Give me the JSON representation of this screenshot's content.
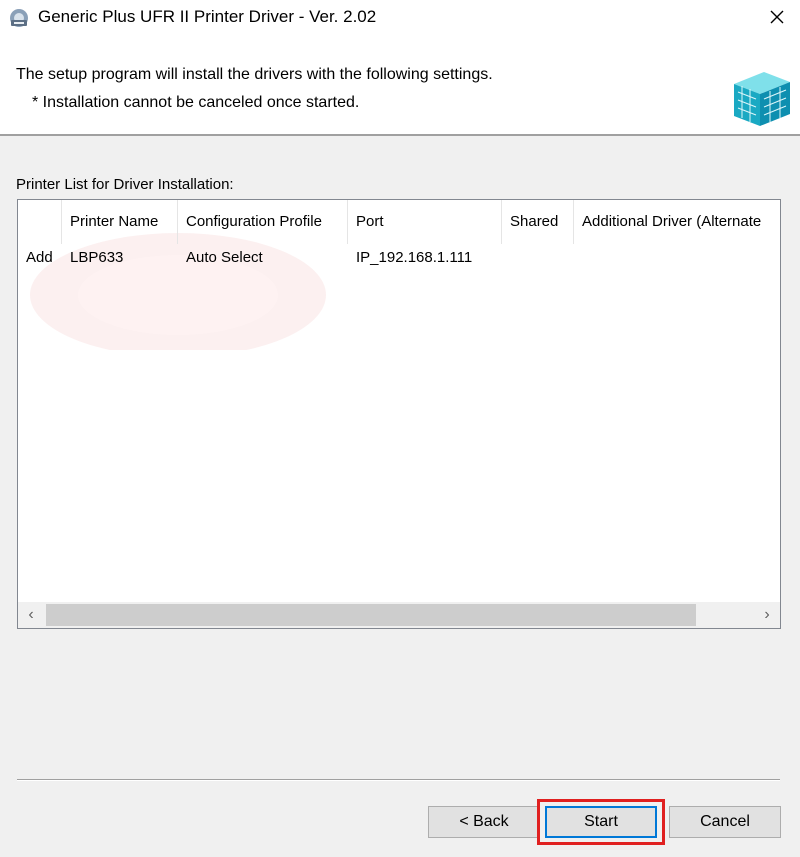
{
  "window": {
    "title": "Generic Plus UFR II Printer Driver - Ver. 2.02",
    "close_glyph": "✕"
  },
  "header": {
    "line1": "The setup program will install the drivers with the following settings.",
    "line2": "* Installation cannot be canceled once started."
  },
  "list": {
    "label": "Printer List for Driver Installation:",
    "columns": [
      "",
      "Printer Name",
      "Configuration Profile",
      "Port",
      "Shared",
      "Additional Driver (Alternate"
    ],
    "rows": [
      [
        "Add",
        "LBP633",
        "Auto Select",
        "IP_192.168.1.111",
        "",
        ""
      ]
    ],
    "scroll_left": "‹",
    "scroll_right": "›"
  },
  "buttons": {
    "back": "< Back",
    "start": "Start",
    "cancel": "Cancel"
  },
  "colors": {
    "focus_border": "#0078d7",
    "highlight": "#e02020"
  }
}
